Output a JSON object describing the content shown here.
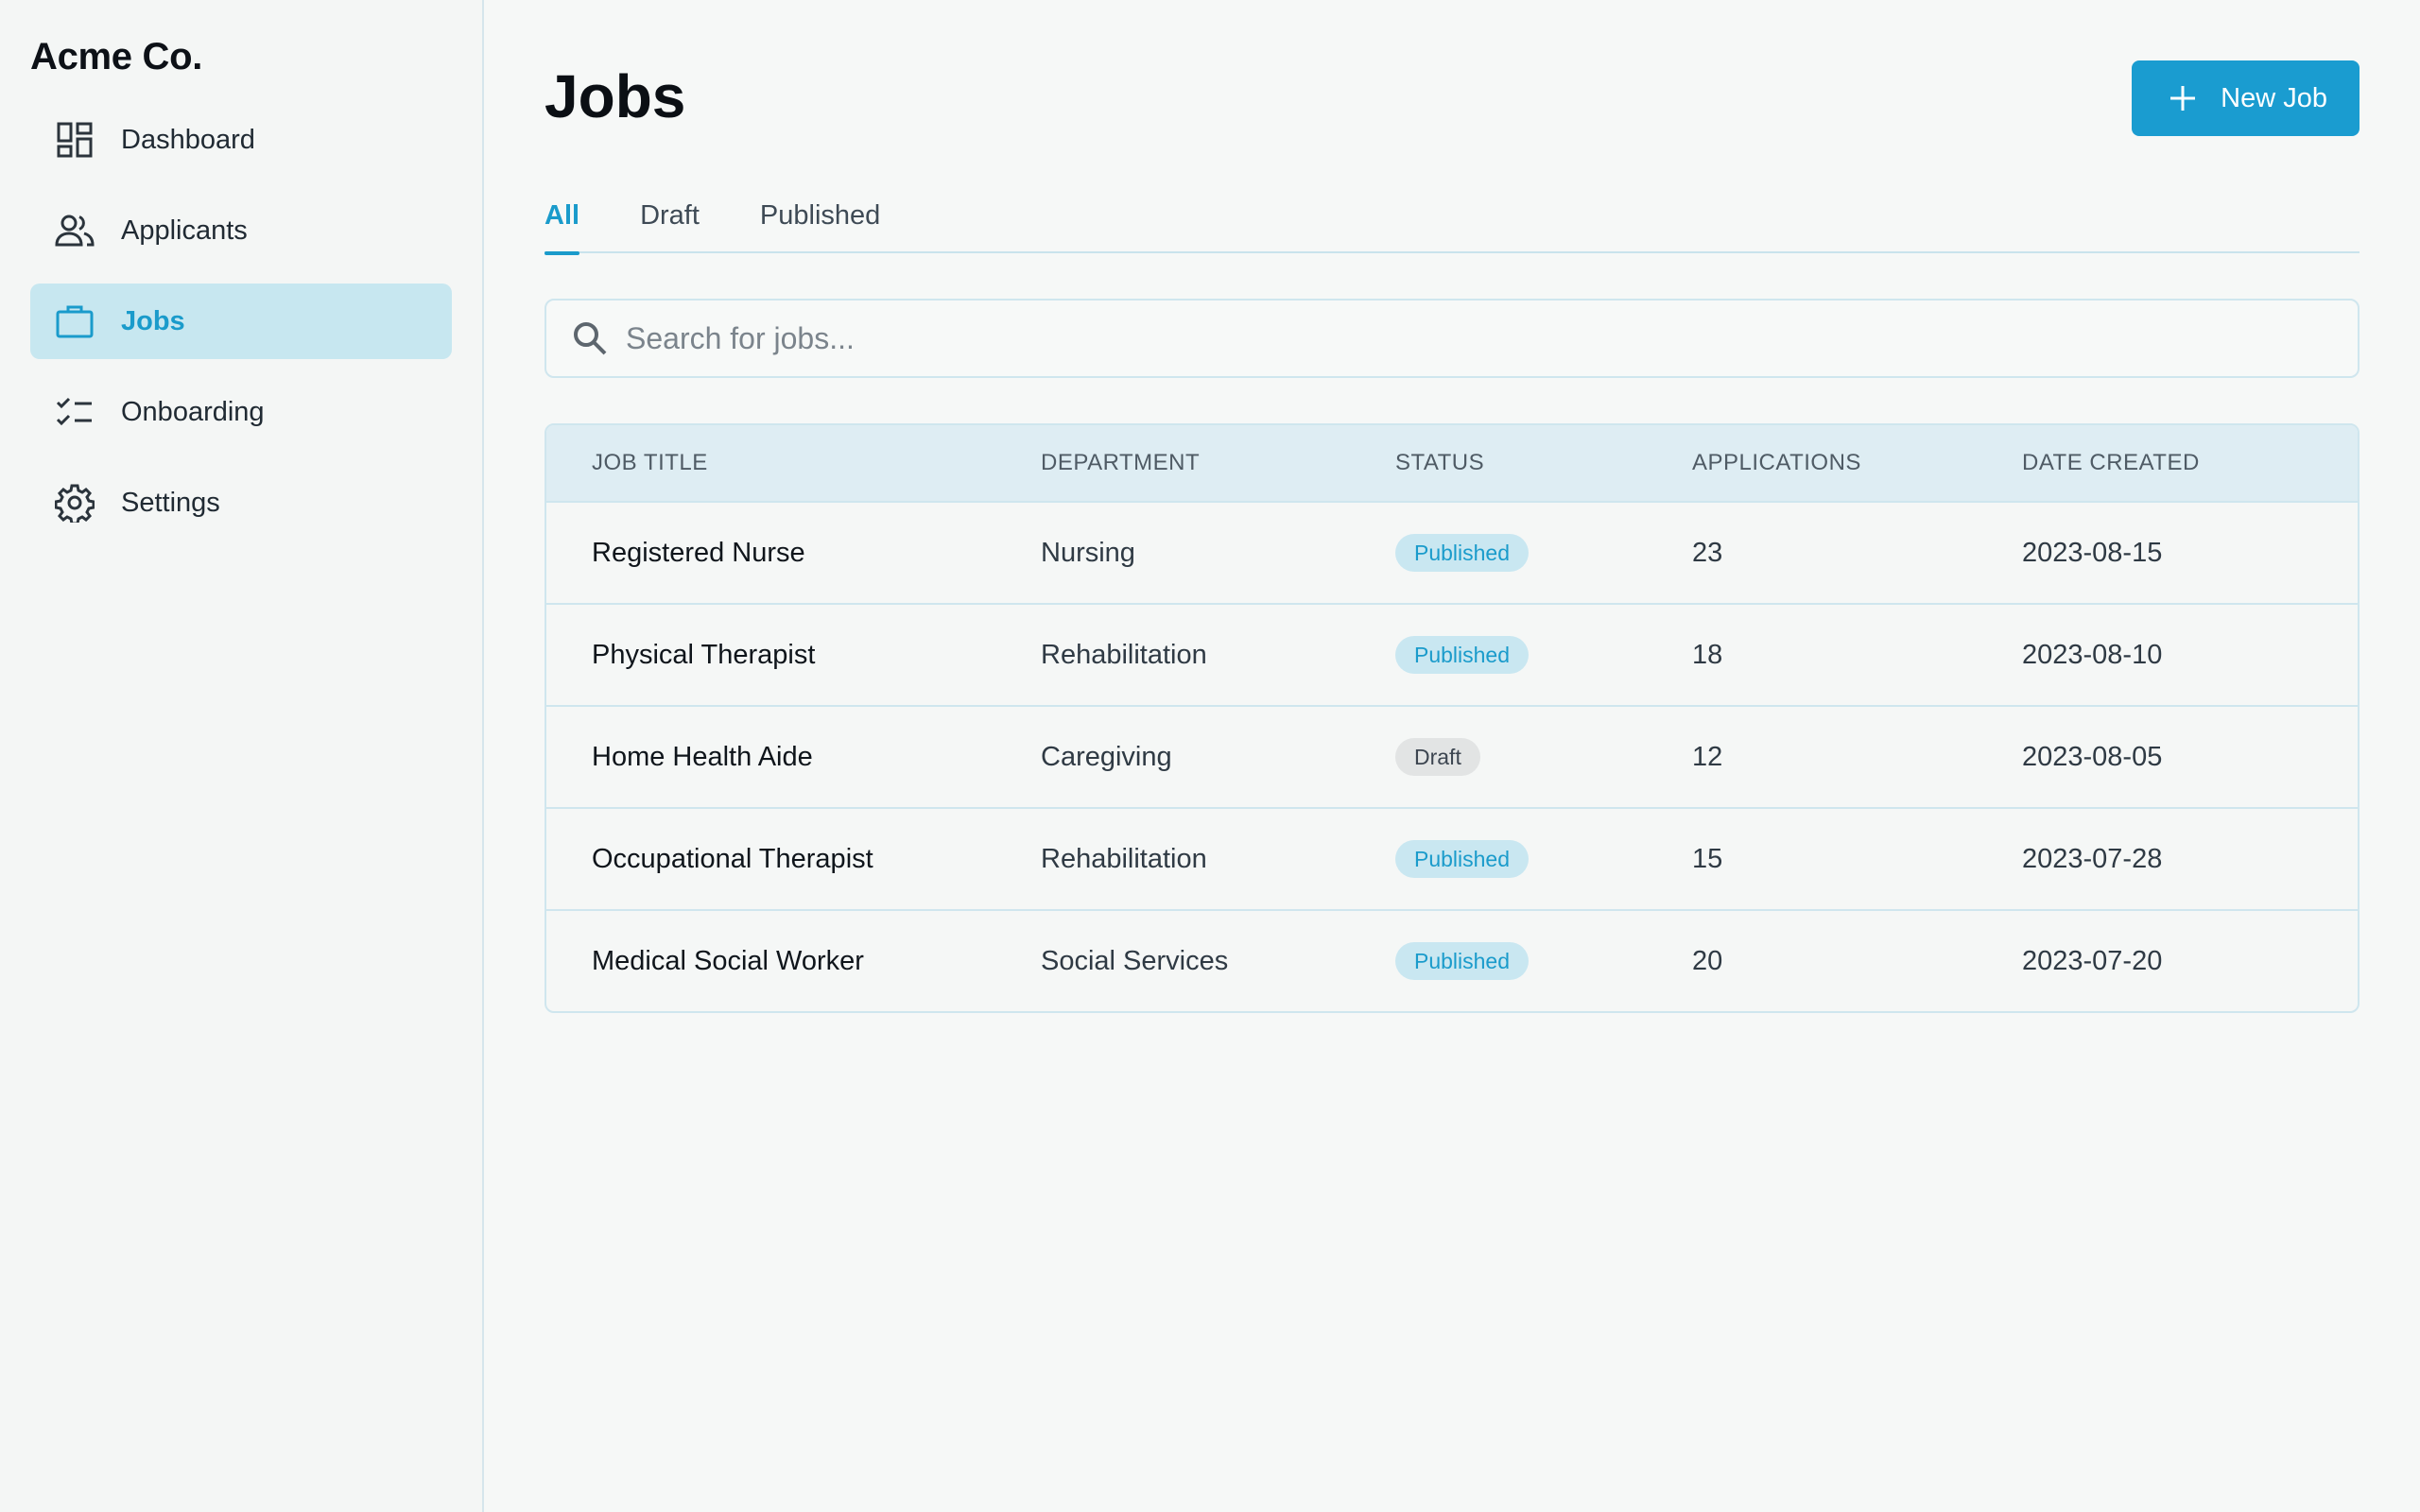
{
  "brand": "Acme Co.",
  "sidebar": {
    "items": [
      {
        "label": "Dashboard",
        "icon": "dashboard-icon",
        "active": false
      },
      {
        "label": "Applicants",
        "icon": "people-icon",
        "active": false
      },
      {
        "label": "Jobs",
        "icon": "briefcase-icon",
        "active": true
      },
      {
        "label": "Onboarding",
        "icon": "checklist-icon",
        "active": false
      },
      {
        "label": "Settings",
        "icon": "gear-icon",
        "active": false
      }
    ]
  },
  "header": {
    "title": "Jobs",
    "new_job_label": "New Job"
  },
  "tabs": [
    {
      "label": "All",
      "active": true
    },
    {
      "label": "Draft",
      "active": false
    },
    {
      "label": "Published",
      "active": false
    }
  ],
  "search": {
    "placeholder": "Search for jobs...",
    "value": ""
  },
  "table": {
    "columns": [
      "JOB TITLE",
      "DEPARTMENT",
      "STATUS",
      "APPLICATIONS",
      "DATE CREATED"
    ],
    "rows": [
      {
        "title": "Registered Nurse",
        "department": "Nursing",
        "status": "Published",
        "applications": "23",
        "date": "2023-08-15"
      },
      {
        "title": "Physical Therapist",
        "department": "Rehabilitation",
        "status": "Published",
        "applications": "18",
        "date": "2023-08-10"
      },
      {
        "title": "Home Health Aide",
        "department": "Caregiving",
        "status": "Draft",
        "applications": "12",
        "date": "2023-08-05"
      },
      {
        "title": "Occupational Therapist",
        "department": "Rehabilitation",
        "status": "Published",
        "applications": "15",
        "date": "2023-07-28"
      },
      {
        "title": "Medical Social Worker",
        "department": "Social Services",
        "status": "Published",
        "applications": "20",
        "date": "2023-07-20"
      }
    ]
  },
  "colors": {
    "accent": "#1a9cd0",
    "active_nav_bg": "#c7e7f0",
    "published_badge_bg": "#c9e7f1",
    "draft_badge_bg": "#e2e4e4"
  }
}
